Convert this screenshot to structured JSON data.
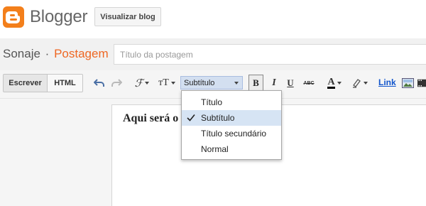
{
  "header": {
    "logo_icon": "blogger-logo-icon",
    "brand": "Blogger",
    "view_blog_label": "Visualizar blog",
    "accent_color": "#f37f1b"
  },
  "post": {
    "blog_name": "Sonaje",
    "separator": "·",
    "section": "Postagem",
    "title_placeholder": "Título da postagem"
  },
  "toolbar": {
    "compose_label": "Escrever",
    "html_label": "HTML",
    "undo_icon": "undo-icon",
    "redo_icon": "redo-icon",
    "font_label": "ℱ",
    "font_size_label": "тT",
    "style_selected": "Subtítulo",
    "bold_label": "B",
    "italic_label": "I",
    "underline_label": "U",
    "strike_label": "ABC",
    "text_color_label": "A",
    "highlight_icon": "highlighter-icon",
    "link_label": "Link",
    "image_icon": "image-icon",
    "video_icon": "video-icon"
  },
  "dropdown": {
    "items": [
      {
        "label": "Título",
        "selected": false
      },
      {
        "label": "Subtítulo",
        "selected": true
      },
      {
        "label": "Título secundário",
        "selected": false
      },
      {
        "label": "Normal",
        "selected": false
      }
    ]
  },
  "editor": {
    "content": "Aqui será o"
  }
}
